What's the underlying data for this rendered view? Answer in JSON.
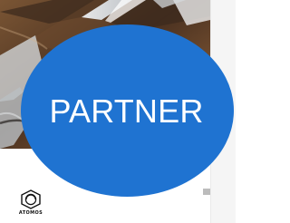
{
  "badge": {
    "label": "PARTNER",
    "color": "#1f73d1",
    "text_color": "#ffffff"
  },
  "card": {
    "image_name": "desk-photo",
    "logo": {
      "icon_name": "atomos-logo-icon",
      "text": "ATOMOS"
    }
  }
}
